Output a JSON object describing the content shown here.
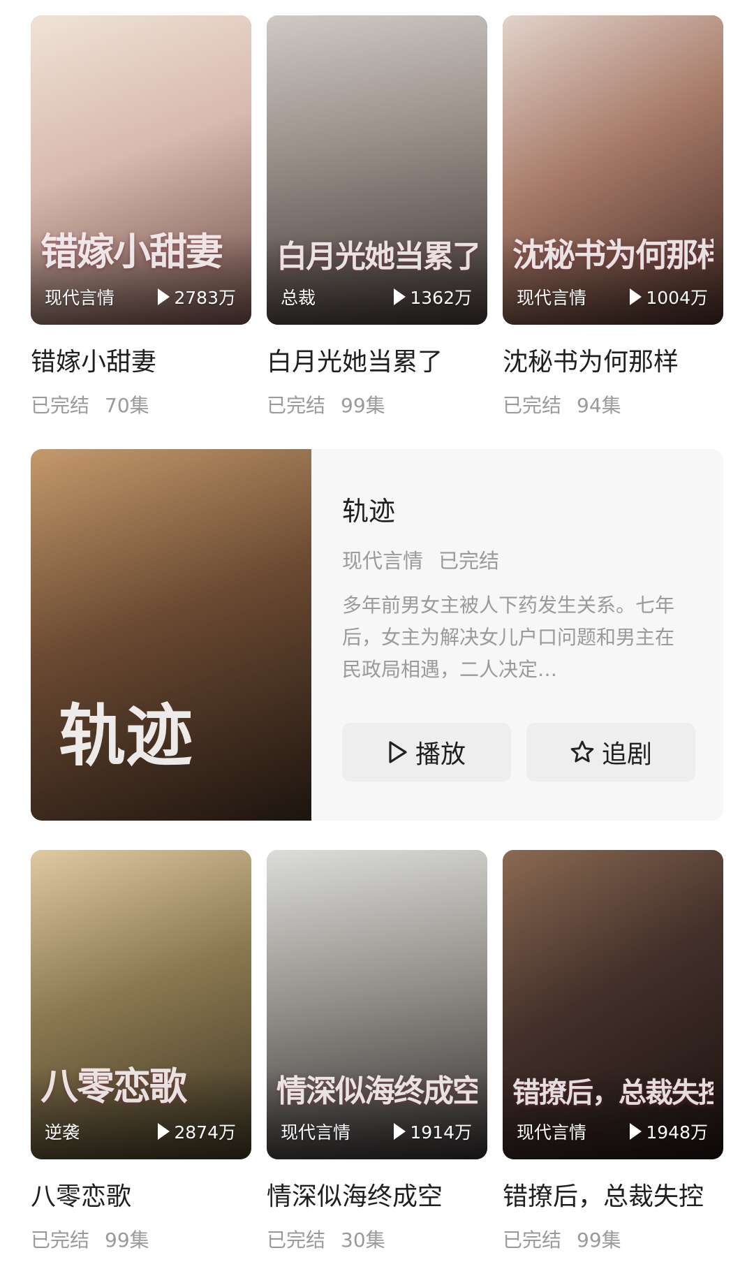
{
  "row1": [
    {
      "title": "错嫁小甜妻",
      "tag": "现代言情",
      "plays": "2783万",
      "status": "已完结",
      "episodes": "70集",
      "poster_text": "错嫁小甜妻",
      "colors": [
        "#e9d7c7",
        "#c9a6a0",
        "#5b3a3a"
      ]
    },
    {
      "title": "白月光她当累了",
      "tag": "总裁",
      "plays": "1362万",
      "status": "已完结",
      "episodes": "99集",
      "poster_text": "白月光她当累了",
      "colors": [
        "#d8d2cc",
        "#8f8580",
        "#3a3230"
      ]
    },
    {
      "title": "沈秘书为何那样",
      "tag": "现代言情",
      "plays": "1004万",
      "status": "已完结",
      "episodes": "94集",
      "poster_text": "沈秘书为何那样",
      "colors": [
        "#d9c6bd",
        "#9c6f5f",
        "#4a2e28"
      ]
    }
  ],
  "featured": {
    "title": "轨迹",
    "genre": "现代言情",
    "status": "已完结",
    "description": "多年前男女主被人下药发生关系。七年后，女主为解决女儿户口问题和男主在民政局相遇，二人决定…",
    "poster_text": "轨迹",
    "play_label": "播放",
    "follow_label": "追剧",
    "colors": [
      "#b98a5c",
      "#5a3c28",
      "#1e1510"
    ]
  },
  "row2": [
    {
      "title": "八零恋歌",
      "tag": "逆袭",
      "plays": "2874万",
      "status": "已完结",
      "episodes": "99集",
      "poster_text": "八零恋歌",
      "colors": [
        "#d9c29a",
        "#7a6a44",
        "#3a3322"
      ]
    },
    {
      "title": "情深似海终成空",
      "tag": "现代言情",
      "plays": "1914万",
      "status": "已完结",
      "episodes": "30集",
      "poster_text": "情深似海终成空",
      "colors": [
        "#d6d6d2",
        "#8c8a86",
        "#2f2b2a"
      ]
    },
    {
      "title": "错撩后，总裁失控",
      "tag": "现代言情",
      "plays": "1948万",
      "status": "已完结",
      "episodes": "99集",
      "poster_text": "错撩后，总裁失控",
      "colors": [
        "#7a5a44",
        "#3b2820",
        "#1a1210"
      ]
    }
  ]
}
